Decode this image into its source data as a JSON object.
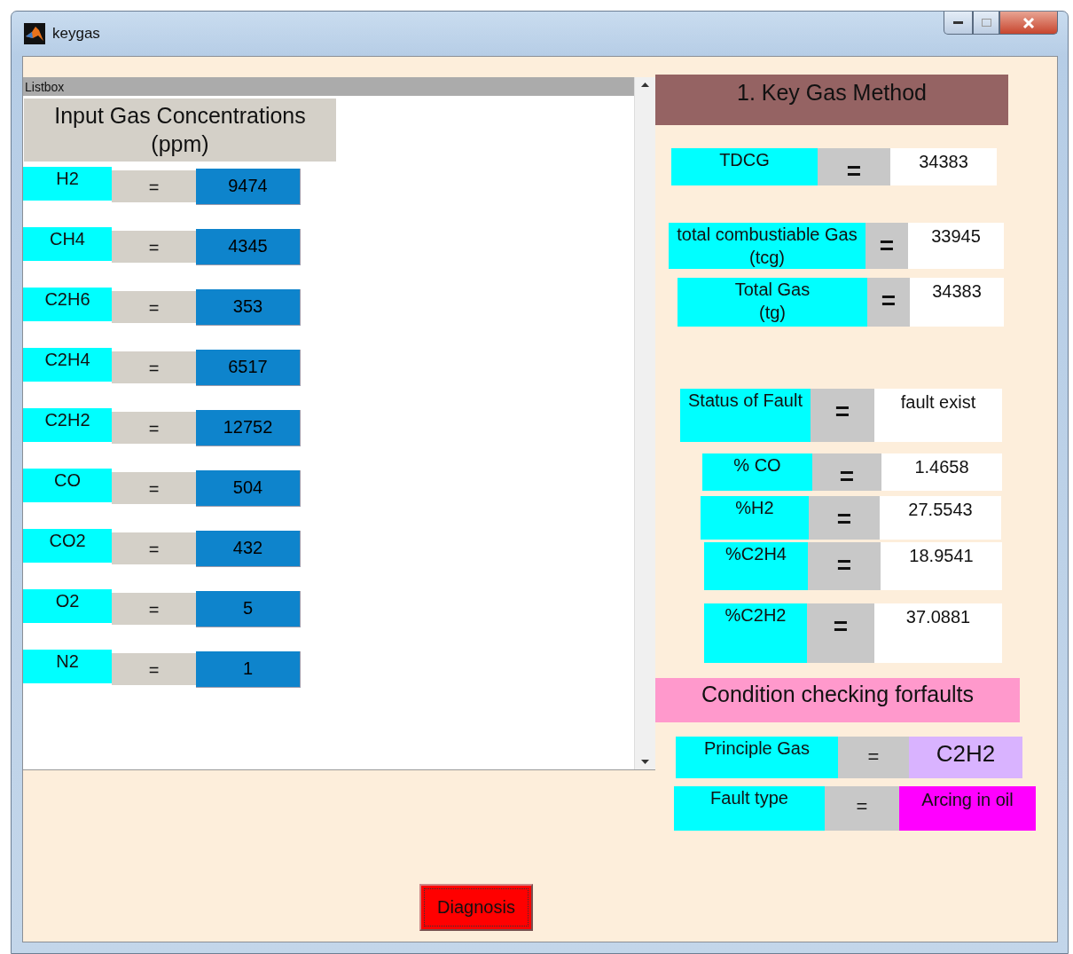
{
  "window": {
    "title": "keygas"
  },
  "listbox": {
    "label": "Listbox",
    "heading": "Input Gas Concentrations\n(ppm)",
    "rows": [
      {
        "gas": "H2",
        "sign": "=",
        "value": "9474"
      },
      {
        "gas": "CH4",
        "sign": "=",
        "value": "4345"
      },
      {
        "gas": "C2H6",
        "sign": "=",
        "value": "353"
      },
      {
        "gas": "C2H4",
        "sign": "=",
        "value": "6517"
      },
      {
        "gas": "C2H2",
        "sign": "=",
        "value": "12752"
      },
      {
        "gas": "CO",
        "sign": "=",
        "value": "504"
      },
      {
        "gas": "CO2",
        "sign": "=",
        "value": "432"
      },
      {
        "gas": "O2",
        "sign": "=",
        "value": "5"
      },
      {
        "gas": "N2",
        "sign": "=",
        "value": "1"
      }
    ]
  },
  "key_gas_method": {
    "title": "1. Key Gas Method",
    "totals": [
      {
        "label": "TDCG",
        "sign": "=",
        "value": "34383"
      },
      {
        "label": "total combustiable Gas\n(tcg)",
        "sign": "=",
        "value": "33945"
      },
      {
        "label": "Total Gas\n(tg)",
        "sign": "=",
        "value": "34383"
      }
    ],
    "status": {
      "label": "Status of Fault",
      "sign": "=",
      "value": "fault exist"
    },
    "percentages": [
      {
        "label": "% CO",
        "sign": "=",
        "value": "1.4658"
      },
      {
        "label": "%H2",
        "sign": "=",
        "value": "27.5543"
      },
      {
        "label": "%C2H4",
        "sign": "=",
        "value": "18.9541"
      },
      {
        "label": "%C2H2",
        "sign": "=",
        "value": "37.0881"
      }
    ]
  },
  "condition": {
    "title": "Condition checking forfaults",
    "results": [
      {
        "label": "Principle Gas",
        "sign": "=",
        "value": "C2H2",
        "color": "#d9b3ff"
      },
      {
        "label": "Fault type",
        "sign": "=",
        "value": "Arcing in oil",
        "color": "#ff00ff"
      }
    ]
  },
  "diagnosis_button": "Diagnosis"
}
